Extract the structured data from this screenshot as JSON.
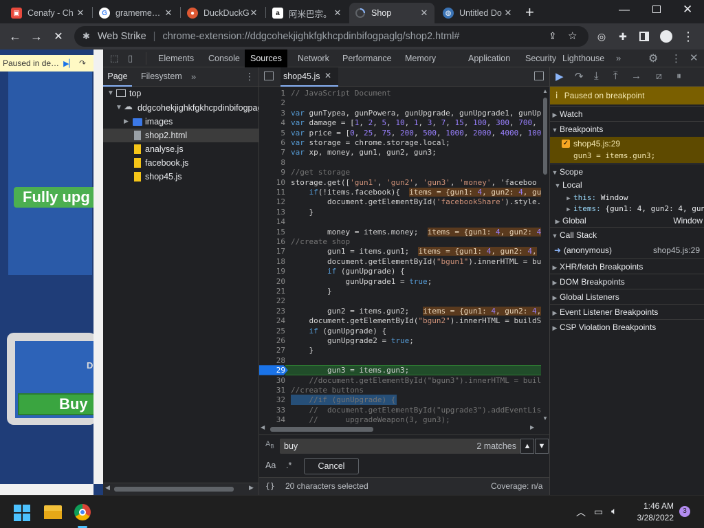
{
  "browser": {
    "tabs": [
      {
        "title": "Cenafy - Ch",
        "icon": "cenafy-icon"
      },
      {
        "title": "grameme…",
        "icon": "google-icon"
      },
      {
        "title": "DuckDuckG",
        "icon": "duckduckgo-icon"
      },
      {
        "title": "阿米巴宗。",
        "icon": "amazon-icon"
      },
      {
        "title": "Shop",
        "icon": "loading-icon"
      },
      {
        "title": "Untitled Do",
        "icon": "globe-icon"
      }
    ],
    "new_tab": "+",
    "site_label": "Web Strike",
    "url": "chrome-extension://ddgcohekjighkfgkhcpdinbifogpaglg/shop2.html#"
  },
  "page": {
    "paused_text": "Paused in de…",
    "fully_upgraded": "Fully upg",
    "d_char": "D",
    "buy_label": "Buy"
  },
  "devtools": {
    "tabs": [
      "Elements",
      "Console",
      "Sources",
      "Network",
      "Performance",
      "Memory",
      "Application",
      "Security",
      "Lighthouse"
    ],
    "active_tab": "Sources",
    "navigator": {
      "tabs": [
        "Page",
        "Filesystem"
      ],
      "top": "top",
      "extension": "ddgcohekjighkfgkhcpdinbifogpag",
      "items": [
        "images",
        "shop2.html",
        "analyse.js",
        "facebook.js",
        "shop45.js"
      ]
    },
    "editor": {
      "file_tab": "shop45.js",
      "current_line": 29,
      "lines": [
        "// JavaScript Document",
        "",
        "var gunTypea, gunPowera, gunUpgrade, gunUpgrade1, gunUp",
        "var damage = [1, 2, 5, 10, 1, 3, 7, 15, 100, 300, 700, 1",
        "var price = [0, 25, 75, 200, 500, 1000, 2000, 4000, 100",
        "var storage = chrome.storage.local;",
        "var xp, money, gun1, gun2, gun3;",
        "",
        "//get storage",
        "storage.get(['gun1', 'gun2', 'gun3', 'money', 'faceboo",
        "    if(!items.facebook){  items = {gun1: 4, gun2: 4, gu",
        "        document.getElementById('facebookShare').style.",
        "    }",
        "",
        "        money = items.money;  items = {gun1: 4, gun2: 4",
        "//create shop",
        "        gun1 = items.gun1;  items = {gun1: 4, gun2: 4,",
        "        document.getElementById(\"bgun1\").innerHTML = bu",
        "        if (gunUpgrade) {",
        "            gunUpgrade1 = true;",
        "        }",
        "",
        "        gun2 = items.gun2;   items = {gun1: 4, gun2: 4,",
        "    document.getElementById(\"bgun2\").innerHTML = buildS",
        "    if (gunUpgrade) {",
        "        gunUpgrade2 = true;",
        "    }",
        "",
        "        gun3 = items.gun3;",
        "    //document.getElementById(\"bgun3\").innerHTML = buil",
        "//create buttons",
        "    //if (gunUpgrade) {",
        "    //  document.getElementById(\"upgrade3\").addEventLis",
        "    //      upgradeWeapon(3, gun3);"
      ]
    },
    "search": {
      "query": "buy",
      "matches": "2 matches",
      "aa": "Aa",
      "regex": ".*",
      "cancel": "Cancel"
    },
    "status": {
      "braces": "{}",
      "selected": "20 characters selected",
      "coverage": "Coverage: n/a"
    },
    "debugger": {
      "paused": "Paused on breakpoint",
      "watch": "Watch",
      "breakpoints": "Breakpoints",
      "bp_file": "shop45.js:29",
      "bp_code": "gun3 = items.gun3;",
      "scope": "Scope",
      "local": "Local",
      "this_key": "this:",
      "this_val": "Window",
      "items_key": "items:",
      "items_val": "{gun1: 4, gun2: 4, gun3",
      "global": "Global",
      "global_val": "Window",
      "call_stack": "Call Stack",
      "frame_name": "(anonymous)",
      "frame_loc": "shop45.js:29",
      "panes": [
        "XHR/fetch Breakpoints",
        "DOM Breakpoints",
        "Global Listeners",
        "Event Listener Breakpoints",
        "CSP Violation Breakpoints"
      ]
    }
  },
  "taskbar": {
    "time": "1:46 AM",
    "date": "3/28/2022",
    "notifications": "3"
  },
  "colors": {
    "accent_blue": "#8ab4f8",
    "paused_bar": "#7a5f00",
    "current_line": "#214d2a",
    "selection": "#264f78"
  }
}
